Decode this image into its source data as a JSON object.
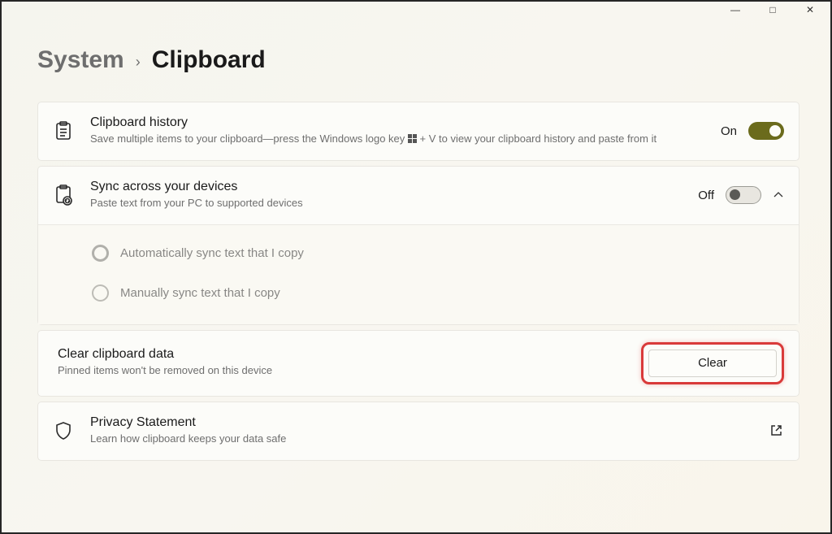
{
  "window": {
    "minimize": "—",
    "maximize": "□",
    "close": "✕"
  },
  "breadcrumb": {
    "parent": "System",
    "chevron": "›",
    "current": "Clipboard"
  },
  "clipboard_history": {
    "title": "Clipboard history",
    "desc_before": "Save multiple items to your clipboard—press the Windows logo key ",
    "desc_after": " + V to view your clipboard history and paste from it",
    "state_label": "On",
    "state": "on"
  },
  "sync": {
    "title": "Sync across your devices",
    "desc": "Paste text from your PC to supported devices",
    "state_label": "Off",
    "state": "off",
    "options": {
      "auto": "Automatically sync text that I copy",
      "manual": "Manually sync text that I copy"
    }
  },
  "clear": {
    "title": "Clear clipboard data",
    "desc": "Pinned items won't be removed on this device",
    "button": "Clear"
  },
  "privacy": {
    "title": "Privacy Statement",
    "desc": "Learn how clipboard keeps your data safe"
  }
}
